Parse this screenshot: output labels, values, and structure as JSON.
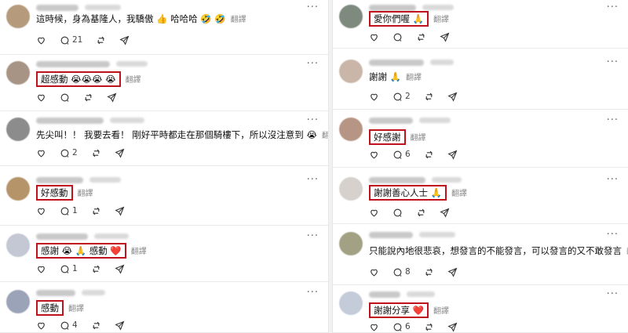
{
  "translate_label": "翻譯",
  "more_label": "···",
  "left_posts": [
    {
      "segments": [
        "這時候，身為基隆人，我驕傲 👍 哈哈哈 🤣 🤣"
      ],
      "highlight": false,
      "comments": "21",
      "avatar_color": "#b59a7c"
    },
    {
      "segments": [
        "超感動 😭😭😭 😭"
      ],
      "highlight": true,
      "comments": "",
      "avatar_color": "#a79484"
    },
    {
      "segments": [
        "先尖叫！！ 我要去看！ 剛好平時都走在那個騎樓下，所以沒注意到 😭"
      ],
      "highlight": false,
      "comments": "2",
      "avatar_color": "#8c8c8c"
    },
    {
      "segments": [
        "好感動"
      ],
      "highlight": true,
      "comments": "1",
      "avatar_color": "#b69469"
    },
    {
      "segments": [
        "感謝 😭 🙏 感動 ❤️"
      ],
      "highlight": true,
      "comments": "1",
      "avatar_color": "#c3c8d4"
    },
    {
      "segments": [
        "感動"
      ],
      "highlight": true,
      "comments": "4",
      "avatar_color": "#9ba3b8"
    }
  ],
  "right_posts": [
    {
      "segments": [
        "愛你們喔 🙏"
      ],
      "highlight": true,
      "comments": "",
      "avatar_color": "#7e8a7e"
    },
    {
      "segments": [
        "謝謝 🙏"
      ],
      "highlight": false,
      "comments": "2",
      "avatar_color": "#c9b6a8"
    },
    {
      "segments": [
        "好感謝"
      ],
      "highlight": true,
      "comments": "6",
      "avatar_color": "#b79584"
    },
    {
      "segments": [
        "謝謝善心人士 🙏"
      ],
      "highlight": true,
      "comments": "",
      "avatar_color": "#d6d1cc"
    },
    {
      "segments": [
        "只能說內地很悲哀，想發言的不能發言，可以發言的又不敢發言"
      ],
      "highlight": false,
      "comments": "8",
      "avatar_color": "#a3a184"
    },
    {
      "segments": [
        "謝謝分享 ❤️"
      ],
      "highlight": true,
      "comments": "6",
      "avatar_color": "#c4ccd9"
    }
  ]
}
